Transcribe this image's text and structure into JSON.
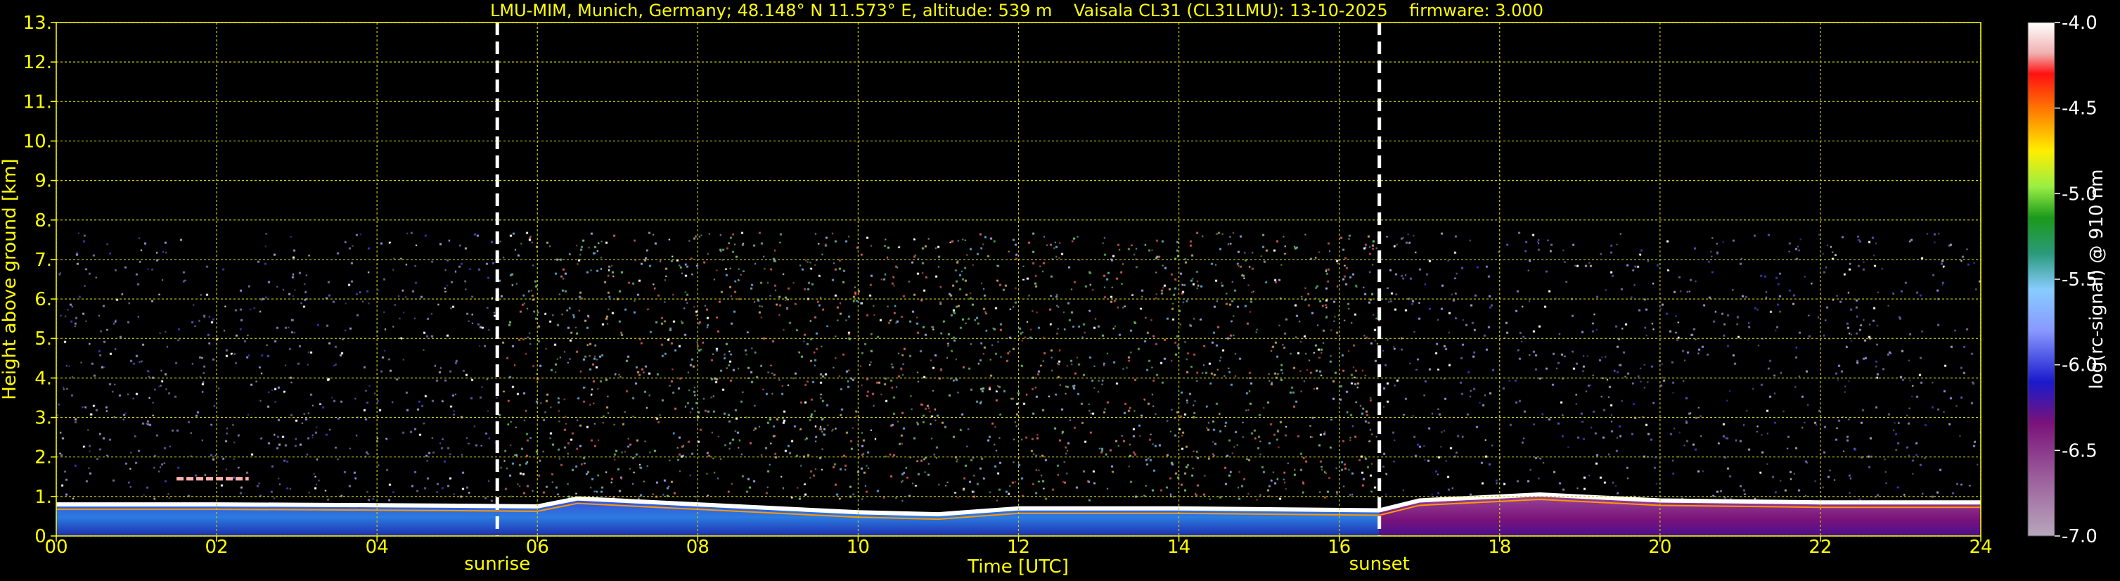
{
  "chart_data": {
    "type": "heatmap",
    "title": "LMU-MIM, Munich, Germany; 48.148° N 11.573° E, altitude: 539 m    Vaisala CL31 (CL31LMU): 13-10-2025    firmware: 3.000",
    "xlabel": "Time [UTC]",
    "ylabel": "Height above ground [km]",
    "xlim": [
      0,
      24
    ],
    "ylim": [
      0,
      13
    ],
    "x_ticks": [
      "00",
      "02",
      "04",
      "06",
      "08",
      "10",
      "12",
      "14",
      "16",
      "18",
      "20",
      "22",
      "24"
    ],
    "y_ticks": [
      "0.",
      "1.",
      "2.",
      "3.",
      "4.",
      "5.",
      "6.",
      "7.",
      "8.",
      "9.",
      "10.",
      "11.",
      "12.",
      "13."
    ],
    "grid": true,
    "colorbar": {
      "label": "log(rc-signal) @ 910 nm",
      "range": [
        -7.0,
        -4.0
      ],
      "ticks": [
        "-4.0",
        "-4.5",
        "-5.0",
        "-5.5",
        "-6.0",
        "-6.5",
        "-7.0"
      ]
    },
    "events": [
      {
        "label": "sunrise",
        "time": 5.5
      },
      {
        "label": "sunset",
        "time": 16.5
      }
    ],
    "noise_top_km": 7.7,
    "boundary_layer_top": [
      {
        "t": 0,
        "h": 0.8
      },
      {
        "t": 2,
        "h": 0.8
      },
      {
        "t": 4,
        "h": 0.78
      },
      {
        "t": 6,
        "h": 0.75
      },
      {
        "t": 6.5,
        "h": 0.95
      },
      {
        "t": 8,
        "h": 0.8
      },
      {
        "t": 10,
        "h": 0.6
      },
      {
        "t": 11,
        "h": 0.55
      },
      {
        "t": 12,
        "h": 0.7
      },
      {
        "t": 14,
        "h": 0.7
      },
      {
        "t": 16.5,
        "h": 0.65
      },
      {
        "t": 17,
        "h": 0.9
      },
      {
        "t": 18.5,
        "h": 1.05
      },
      {
        "t": 20,
        "h": 0.9
      },
      {
        "t": 22,
        "h": 0.85
      },
      {
        "t": 24,
        "h": 0.85
      }
    ],
    "aerosol_layer": {
      "t_start": 1.5,
      "t_end": 2.4,
      "h": 1.45
    }
  }
}
